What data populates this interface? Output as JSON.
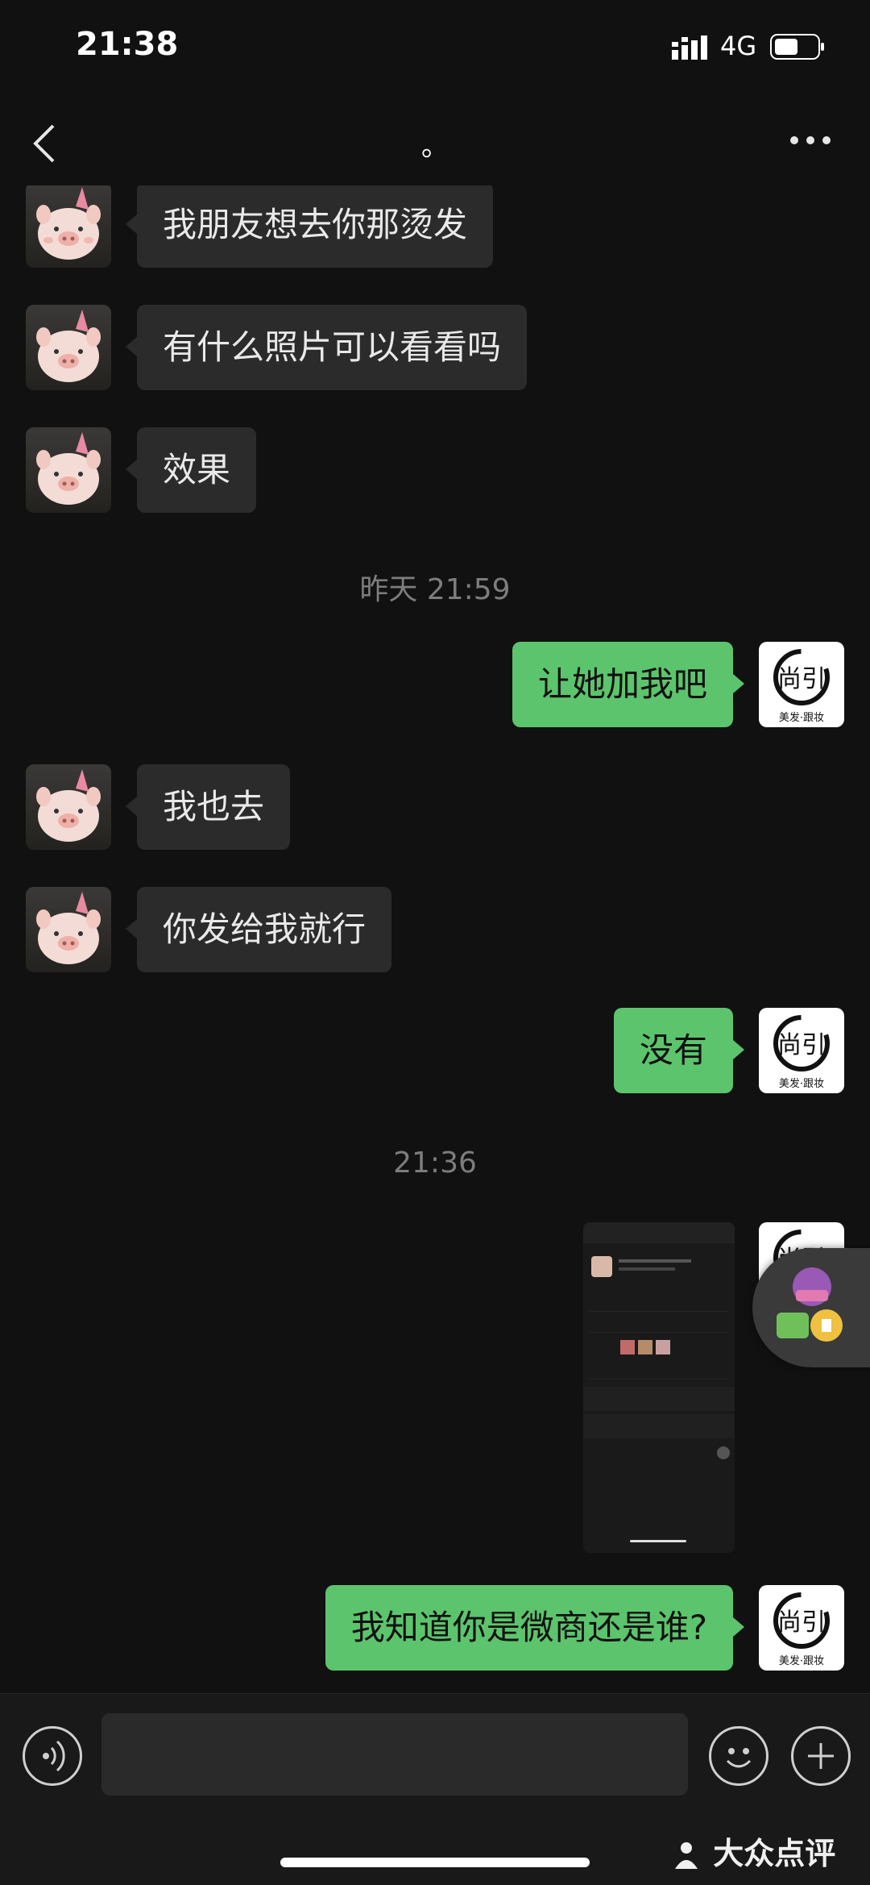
{
  "status": {
    "time": "21:38",
    "network": "4G"
  },
  "nav": {
    "title": "。"
  },
  "messages": {
    "m1": "我朋友想去你那烫发",
    "m2": "有什么照片可以看看吗",
    "m3": "效果",
    "ts1": "昨天 21:59",
    "m4": "让她加我吧",
    "m5": "我也去",
    "m6": "你发给我就行",
    "m7": "没有",
    "ts2": "21:36",
    "m8": "我知道你是微商还是谁?"
  },
  "self_avatar": {
    "logo_text": "尚引",
    "tagline": "美发·跟妆"
  },
  "watermark": "大众点评",
  "colors": {
    "outgoing": "#5cc46c",
    "incoming": "#2b2b2b",
    "background": "#111111"
  }
}
